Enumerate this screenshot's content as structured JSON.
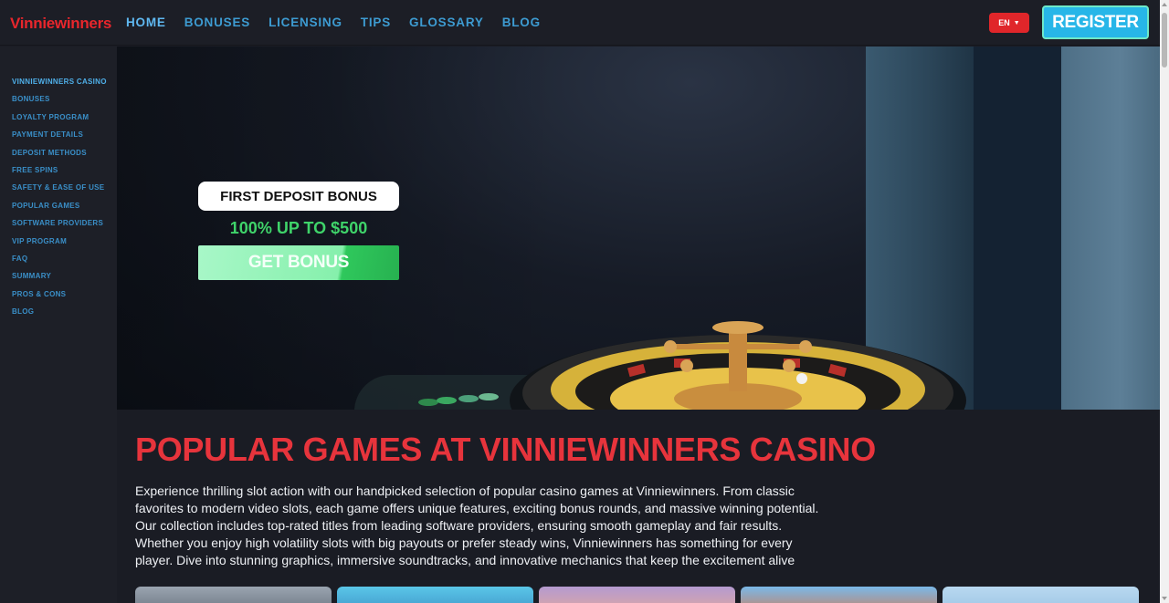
{
  "header": {
    "logo": "Vinniewinners",
    "nav": [
      {
        "label": "HOME",
        "active": true
      },
      {
        "label": "BONUSES"
      },
      {
        "label": "LICENSING"
      },
      {
        "label": "TIPS"
      },
      {
        "label": "GLOSSARY"
      },
      {
        "label": "BLOG"
      }
    ],
    "language": "EN",
    "register_label": "REGISTER"
  },
  "sidebar": {
    "items": [
      {
        "label": "VINNIEWINNERS CASINO",
        "active": true
      },
      {
        "label": "BONUSES"
      },
      {
        "label": "LOYALTY PROGRAM"
      },
      {
        "label": "PAYMENT DETAILS"
      },
      {
        "label": "DEPOSIT METHODS"
      },
      {
        "label": "FREE SPINS"
      },
      {
        "label": "SAFETY & EASE OF USE"
      },
      {
        "label": "POPULAR GAMES"
      },
      {
        "label": "SOFTWARE PROVIDERS"
      },
      {
        "label": "VIP PROGRAM"
      },
      {
        "label": "FAQ"
      },
      {
        "label": "SUMMARY"
      },
      {
        "label": "PROS & CONS"
      },
      {
        "label": "BLOG"
      }
    ]
  },
  "hero": {
    "badge": "FIRST DEPOSIT BONUS",
    "amount": "100% UP TO $500",
    "cta": "GET BONUS"
  },
  "main": {
    "title": "POPULAR GAMES AT VINNIEWINNERS CASINO",
    "description": "Experience thrilling slot action with our handpicked selection of popular casino games at Vinniewinners. From classic favorites to modern video slots, each game offers unique features, exciting bonus rounds, and massive winning potential. Our collection includes top-rated titles from leading software providers, ensuring smooth gameplay and fair results. Whether you enjoy high volatility slots with big payouts or prefer steady wins, Vinniewinners has something for every player. Dive into stunning graphics, immersive soundtracks, and innovative mechanics that keep the excitement alive"
  },
  "colors": {
    "brand_red": "#e8262c",
    "nav_blue": "#3d9bd1",
    "register_blue": "#27b6e8",
    "bonus_green": "#3fd46a",
    "title_red": "#e7343c"
  }
}
